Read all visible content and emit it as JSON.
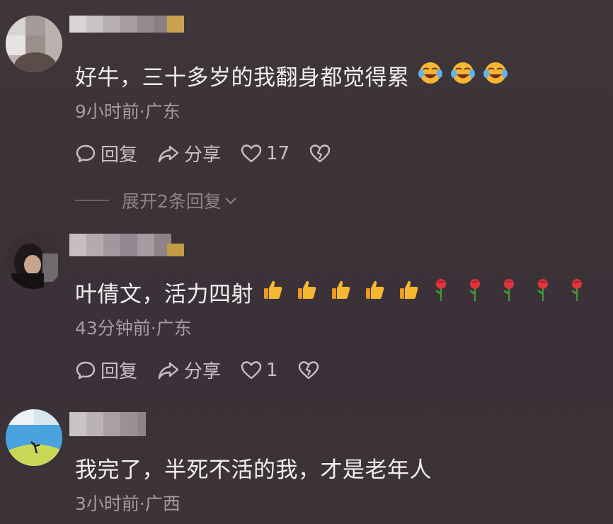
{
  "comments": [
    {
      "text": "好牛，三十多岁的我翻身都觉得累",
      "emoji": [
        "laugh-cry",
        "laugh-cry",
        "laugh-cry"
      ],
      "meta": "9小时前·广东",
      "reply_label": "回复",
      "share_label": "分享",
      "like_count": "17",
      "expand_label": "展开2条回复"
    },
    {
      "text": "叶倩文，活力四射",
      "emoji": [
        "thumbs-up",
        "thumbs-up",
        "thumbs-up",
        "thumbs-up",
        "thumbs-up",
        "rose",
        "rose",
        "rose",
        "rose",
        "rose"
      ],
      "meta": "43分钟前·广东",
      "reply_label": "回复",
      "share_label": "分享",
      "like_count": "1"
    },
    {
      "text": "我完了，半死不活的我，才是老年人",
      "meta": "3小时前·广西"
    }
  ]
}
